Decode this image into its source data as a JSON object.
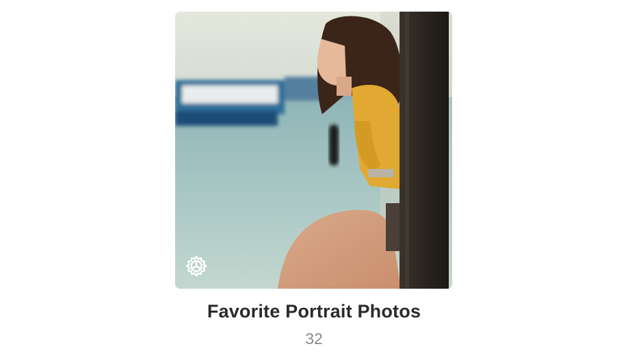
{
  "album": {
    "title": "Favorite Portrait Photos",
    "count": "32",
    "badge_icon": "smart-album-gear-icon",
    "thumbnail": "woman-in-yellow-sweater-on-pier-photo"
  },
  "colors": {
    "title": "#2b2b2b",
    "count": "#8a8a8a",
    "background": "#ffffff"
  }
}
